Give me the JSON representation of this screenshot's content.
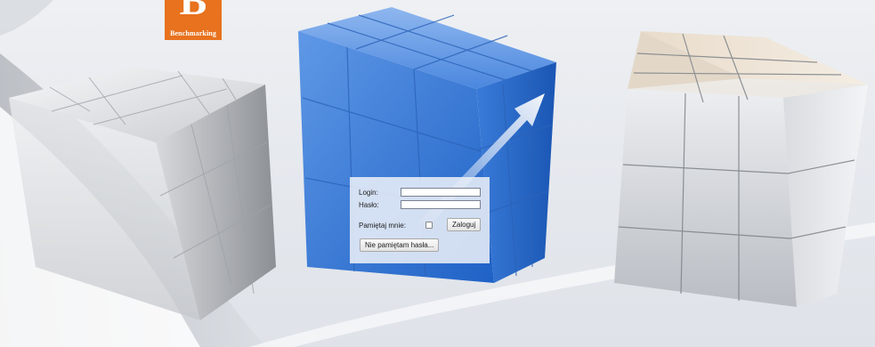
{
  "logo": {
    "letter": "B",
    "name": "Benchmarking"
  },
  "login": {
    "login_label": "Login:",
    "login_value": "",
    "password_label": "Hasło:",
    "password_value": "",
    "remember_label": "Pamiętaj mnie:",
    "remember_checked": false,
    "submit_label": "Zaloguj",
    "forgot_label": "Nie pamiętam hasła..."
  },
  "colors": {
    "brand": "#e8721e",
    "cube_blue": "#3d7fdc",
    "panel_bg": "#eef1f8"
  }
}
